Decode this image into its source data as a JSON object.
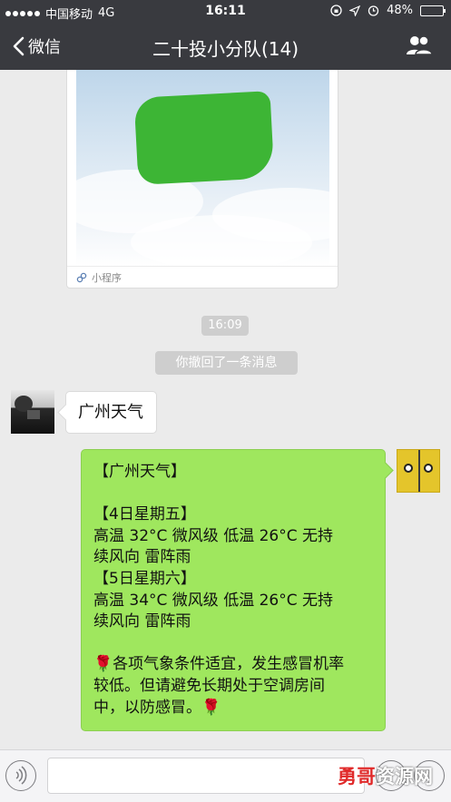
{
  "status_bar": {
    "carrier": "中国移动",
    "network": "4G",
    "time": "16:11",
    "battery": "48%",
    "battery_fraction": 0.48
  },
  "nav": {
    "back_label": "微信",
    "title": "二十投小分队(14)"
  },
  "miniprogram_card": {
    "footer_label": "小程序"
  },
  "system": {
    "time_label": "16:09",
    "recall_notice": "你撤回了一条消息"
  },
  "messages": {
    "incoming_text": "广州天气",
    "outgoing_lines": [
      "【广州天气】",
      "",
      "【4日星期五】",
      "高温 32°C  微风级  低温 26°C  无持",
      "续风向  雷阵雨",
      "【5日星期六】",
      "高温 34°C  微风级  低温 26°C  无持",
      "续风向  雷阵雨",
      "",
      "🌹各项气象条件适宜，发生感冒机率",
      "较低。但请避免长期处于空调房间",
      "中，以防感冒。🌹"
    ]
  },
  "watermark": {
    "part1": "勇哥",
    "part2": "资源网"
  },
  "colors": {
    "header_bg": "#393a3f",
    "chat_bg": "#ebebeb",
    "outgoing_bubble": "#9fe75e",
    "incoming_bubble": "#ffffff",
    "miniprogram_blob": "#3db535"
  }
}
